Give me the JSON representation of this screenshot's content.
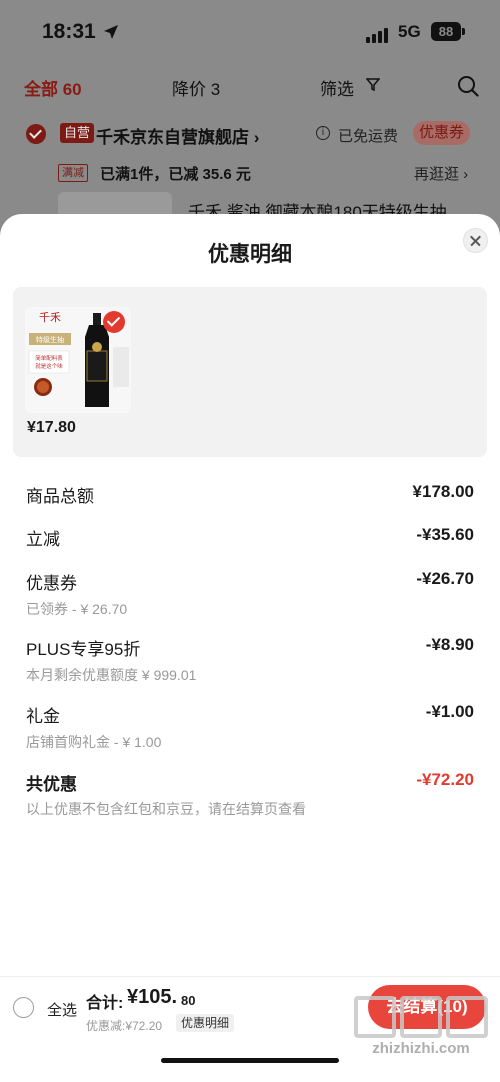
{
  "status_bar": {
    "time": "18:31",
    "network": "5G",
    "battery": "88"
  },
  "tabs": [
    {
      "label": "全部 60"
    },
    {
      "label": "降价 3"
    },
    {
      "label": "筛选"
    }
  ],
  "shop": {
    "self_tag": "自营",
    "name": "千禾京东自营旗舰店 ›",
    "free_shipping": "已免运费",
    "coupon": "优惠券"
  },
  "promo": {
    "tag": "满减",
    "text": "已满1件，已减 35.6 元",
    "more": "再逛逛 ›"
  },
  "bg_product_title": "千禾 酱油 御藏本酿180天特级生抽",
  "sheet": {
    "title": "优惠明细",
    "product": {
      "price": "¥17.80",
      "image_label": "特级生抽",
      "image_text": "简单配料表 就是这个味"
    },
    "rows": {
      "goods_total": {
        "label": "商品总额",
        "value": "¥178.00"
      },
      "instant": {
        "label": "立减",
        "value": "-¥35.60"
      },
      "coupon": {
        "label": "优惠券",
        "value": "-¥26.70",
        "sub": "已领券 - ¥ 26.70"
      },
      "plus": {
        "label": "PLUS专享95折",
        "value": "-¥8.90",
        "sub": "本月剩余优惠额度 ¥ 999.01"
      },
      "gift": {
        "label": "礼金",
        "value": "-¥1.00",
        "sub": "店铺首购礼金 - ¥ 1.00"
      },
      "total": {
        "label": "共优惠",
        "value": "-¥72.20"
      }
    },
    "note": "以上优惠不包含红包和京豆，请在结算页查看"
  },
  "checkout": {
    "select_all": "全选",
    "total_label": "合计:",
    "total_amount": "¥105.",
    "total_cents": "80",
    "discount": "优惠减:¥72.20",
    "detail_button": "优惠明细",
    "checkout_button": "去结算(10)"
  },
  "watermark": {
    "text": "zhizhizhi.com"
  },
  "colors": {
    "accent": "#e23a2e",
    "checkout": "#e8453c",
    "muted": "#999999"
  }
}
